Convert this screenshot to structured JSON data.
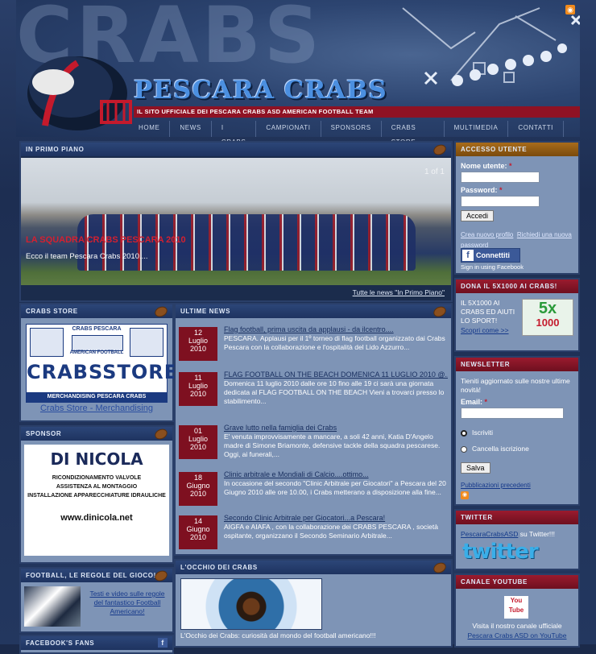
{
  "header": {
    "bg_word": "CRABS",
    "brand": "PESCARA CRABS",
    "tagline": "IL SITO UFFICIALE DEI PESCARA CRABS ASD AMERICAN FOOTBALL TEAM"
  },
  "nav": [
    "HOME",
    "NEWS",
    "I CRABS",
    "CAMPIONATI",
    "SPONSORS",
    "CRABS STORE",
    "MULTIMEDIA",
    "CONTATTI"
  ],
  "featured": {
    "title": "IN PRIMO PIANO",
    "counter": "1 of 1",
    "headline": "LA SQUADRA CRABS PESCARA 2010",
    "caption": "Ecco il team Pescara Crabs 2010....",
    "all_news_link": "Tutte le news \"In Primo Piano\""
  },
  "login": {
    "title": "ACCESSO UTENTE",
    "username_label": "Nome utente:",
    "password_label": "Password:",
    "required": "*",
    "submit": "Accedi",
    "new_profile": "Crea nuovo profilo",
    "new_password": "Richiedi una nuova password",
    "facebook_button": "Connettiti",
    "facebook_sub": "Sign in using Facebook"
  },
  "five_x_thousand": {
    "title": "DONA IL 5X1000 AI CRABS!",
    "text": "IL 5X1000 AI CRABS ED AIUTI LO SPORT!",
    "link": "Scopri come >>",
    "logo_top": "5x",
    "logo_bottom": "1000"
  },
  "store": {
    "title": "CRABS STORE",
    "banner_top_center": "CRABS PESCARA",
    "banner_sub": "AMERICAN FOOTBALL",
    "banner_mid": "CRABS",
    "banner_store": "STORE",
    "banner_bottom": "MERCHANDISING PESCARA CRABS",
    "link": "Crabs Store - Merchandising"
  },
  "sponsor": {
    "title": "SPONSOR",
    "brand": "DI NICOLA",
    "line1": "RICONDIZIONAMENTO VALVOLE",
    "line2": "ASSISTENZA AL MONTAGGIO",
    "line3": "INSTALLAZIONE APPARECCHIATURE IDRAULICHE",
    "site": "www.dinicola.net"
  },
  "rules": {
    "title": "FOOTBALL, LE REGOLE DEL GIOCO!",
    "link": "Testi e video sulle regole del fantastico Football Americano!"
  },
  "fans": {
    "title": "FACEBOOK'S FANS"
  },
  "news": {
    "title": "ULTIME NEWS",
    "items": [
      {
        "day": "12",
        "month": "Luglio",
        "year": "2010",
        "title": "Flag football, prima uscita da applausi - da ilcentro....",
        "text": "PESCARA. Applausi per il 1º torneo di flag football organizzato dai Crabs Pescara con la collaborazione e l'ospitalità del Lido Azzurro..."
      },
      {
        "day": "11",
        "month": "Luglio",
        "year": "2010",
        "title": "FLAG FOOTBALL ON THE BEACH DOMENICA 11 LUGLIO 2010 @...",
        "text": "Domenica 11 luglio 2010 dalle ore 10 fino alle 19 ci sarà una giornata dedicata al FLAG FOOTBALL ON THE BEACH Vieni a trovarci presso lo stabilimento..."
      },
      {
        "day": "01",
        "month": "Luglio",
        "year": "2010",
        "title": "Grave lutto nella famiglia dei Crabs",
        "text": "E' venuta improvvisamente a mancare, a soli 42 anni, Katia D'Angelo madre di Simone Briamonte, defensive tackle della squadra pescarese. Oggi, ai funerali,..."
      },
      {
        "day": "18",
        "month": "Giugno",
        "year": "2010",
        "title": "Clinic arbitrale e Mondiali di Calcio....ottimo...",
        "text": "In occasione del secondo \"Clinic Arbitrale per Giocatori\" a Pescara del 20 Giugno 2010 alle ore 10.00, i Crabs metterano a disposizione alla fine..."
      },
      {
        "day": "14",
        "month": "Giugno",
        "year": "2010",
        "title": "Secondo Clinic Arbitrale per Giocatori...a Pescara!",
        "text": "AIGFA e AIAFA , con la collaborazione dei CRABS PESCARA , società ospitante, organizzano il Secondo Seminario Arbitrale..."
      }
    ]
  },
  "eye": {
    "title": "L'OCCHIO DEI CRABS",
    "caption": "L'Occhio dei Crabs: curiosità dal mondo del football americano!!!"
  },
  "newsletter": {
    "title": "NEWSLETTER",
    "intro": "Tieniti aggiornato sulle nostre ultime novità!",
    "email_label": "Email:",
    "required": "*",
    "subscribe": "Iscriviti",
    "unsubscribe": "Cancella iscrizione",
    "submit": "Salva",
    "previous": "Pubblicazioni precedenti"
  },
  "twitter": {
    "title": "TWITTER",
    "user_link": "PescaraCrabsASD",
    "suffix": " su Twitter!!!",
    "logo": "twitter"
  },
  "youtube": {
    "title": "CANALE YOUTUBE",
    "logo": "You Tube",
    "text": "Visita il nostro canale ufficiale",
    "link": "Pescara Crabs ASD on YouTube"
  },
  "colors": {
    "accent_red": "#8f1224",
    "nav_blue": "#1e3360",
    "panel_bg": "#7e94b6"
  },
  "icons": [
    "rss-icon",
    "football-icon",
    "facebook-icon"
  ]
}
